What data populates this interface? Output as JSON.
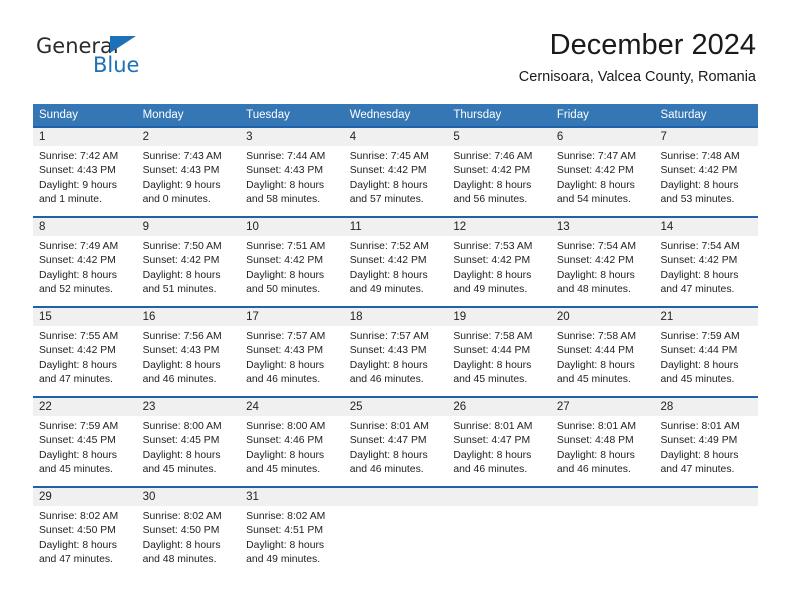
{
  "brand": {
    "name_part1": "General",
    "name_part2": "Blue",
    "accent_color": "#1d71b8",
    "triangle_icon": "triangle-icon"
  },
  "header": {
    "title": "December 2024",
    "subtitle": "Cernisoara, Valcea County, Romania"
  },
  "calendar": {
    "header_bg": "#3576b5",
    "rule_color": "#1f62ab",
    "day_band_bg": "#f0f0f0",
    "weekdays": [
      "Sunday",
      "Monday",
      "Tuesday",
      "Wednesday",
      "Thursday",
      "Friday",
      "Saturday"
    ],
    "weeks": [
      [
        {
          "day": "1",
          "sunrise": "Sunrise: 7:42 AM",
          "sunset": "Sunset: 4:43 PM",
          "daylight1": "Daylight: 9 hours",
          "daylight2": "and 1 minute."
        },
        {
          "day": "2",
          "sunrise": "Sunrise: 7:43 AM",
          "sunset": "Sunset: 4:43 PM",
          "daylight1": "Daylight: 9 hours",
          "daylight2": "and 0 minutes."
        },
        {
          "day": "3",
          "sunrise": "Sunrise: 7:44 AM",
          "sunset": "Sunset: 4:43 PM",
          "daylight1": "Daylight: 8 hours",
          "daylight2": "and 58 minutes."
        },
        {
          "day": "4",
          "sunrise": "Sunrise: 7:45 AM",
          "sunset": "Sunset: 4:42 PM",
          "daylight1": "Daylight: 8 hours",
          "daylight2": "and 57 minutes."
        },
        {
          "day": "5",
          "sunrise": "Sunrise: 7:46 AM",
          "sunset": "Sunset: 4:42 PM",
          "daylight1": "Daylight: 8 hours",
          "daylight2": "and 56 minutes."
        },
        {
          "day": "6",
          "sunrise": "Sunrise: 7:47 AM",
          "sunset": "Sunset: 4:42 PM",
          "daylight1": "Daylight: 8 hours",
          "daylight2": "and 54 minutes."
        },
        {
          "day": "7",
          "sunrise": "Sunrise: 7:48 AM",
          "sunset": "Sunset: 4:42 PM",
          "daylight1": "Daylight: 8 hours",
          "daylight2": "and 53 minutes."
        }
      ],
      [
        {
          "day": "8",
          "sunrise": "Sunrise: 7:49 AM",
          "sunset": "Sunset: 4:42 PM",
          "daylight1": "Daylight: 8 hours",
          "daylight2": "and 52 minutes."
        },
        {
          "day": "9",
          "sunrise": "Sunrise: 7:50 AM",
          "sunset": "Sunset: 4:42 PM",
          "daylight1": "Daylight: 8 hours",
          "daylight2": "and 51 minutes."
        },
        {
          "day": "10",
          "sunrise": "Sunrise: 7:51 AM",
          "sunset": "Sunset: 4:42 PM",
          "daylight1": "Daylight: 8 hours",
          "daylight2": "and 50 minutes."
        },
        {
          "day": "11",
          "sunrise": "Sunrise: 7:52 AM",
          "sunset": "Sunset: 4:42 PM",
          "daylight1": "Daylight: 8 hours",
          "daylight2": "and 49 minutes."
        },
        {
          "day": "12",
          "sunrise": "Sunrise: 7:53 AM",
          "sunset": "Sunset: 4:42 PM",
          "daylight1": "Daylight: 8 hours",
          "daylight2": "and 49 minutes."
        },
        {
          "day": "13",
          "sunrise": "Sunrise: 7:54 AM",
          "sunset": "Sunset: 4:42 PM",
          "daylight1": "Daylight: 8 hours",
          "daylight2": "and 48 minutes."
        },
        {
          "day": "14",
          "sunrise": "Sunrise: 7:54 AM",
          "sunset": "Sunset: 4:42 PM",
          "daylight1": "Daylight: 8 hours",
          "daylight2": "and 47 minutes."
        }
      ],
      [
        {
          "day": "15",
          "sunrise": "Sunrise: 7:55 AM",
          "sunset": "Sunset: 4:42 PM",
          "daylight1": "Daylight: 8 hours",
          "daylight2": "and 47 minutes."
        },
        {
          "day": "16",
          "sunrise": "Sunrise: 7:56 AM",
          "sunset": "Sunset: 4:43 PM",
          "daylight1": "Daylight: 8 hours",
          "daylight2": "and 46 minutes."
        },
        {
          "day": "17",
          "sunrise": "Sunrise: 7:57 AM",
          "sunset": "Sunset: 4:43 PM",
          "daylight1": "Daylight: 8 hours",
          "daylight2": "and 46 minutes."
        },
        {
          "day": "18",
          "sunrise": "Sunrise: 7:57 AM",
          "sunset": "Sunset: 4:43 PM",
          "daylight1": "Daylight: 8 hours",
          "daylight2": "and 46 minutes."
        },
        {
          "day": "19",
          "sunrise": "Sunrise: 7:58 AM",
          "sunset": "Sunset: 4:44 PM",
          "daylight1": "Daylight: 8 hours",
          "daylight2": "and 45 minutes."
        },
        {
          "day": "20",
          "sunrise": "Sunrise: 7:58 AM",
          "sunset": "Sunset: 4:44 PM",
          "daylight1": "Daylight: 8 hours",
          "daylight2": "and 45 minutes."
        },
        {
          "day": "21",
          "sunrise": "Sunrise: 7:59 AM",
          "sunset": "Sunset: 4:44 PM",
          "daylight1": "Daylight: 8 hours",
          "daylight2": "and 45 minutes."
        }
      ],
      [
        {
          "day": "22",
          "sunrise": "Sunrise: 7:59 AM",
          "sunset": "Sunset: 4:45 PM",
          "daylight1": "Daylight: 8 hours",
          "daylight2": "and 45 minutes."
        },
        {
          "day": "23",
          "sunrise": "Sunrise: 8:00 AM",
          "sunset": "Sunset: 4:45 PM",
          "daylight1": "Daylight: 8 hours",
          "daylight2": "and 45 minutes."
        },
        {
          "day": "24",
          "sunrise": "Sunrise: 8:00 AM",
          "sunset": "Sunset: 4:46 PM",
          "daylight1": "Daylight: 8 hours",
          "daylight2": "and 45 minutes."
        },
        {
          "day": "25",
          "sunrise": "Sunrise: 8:01 AM",
          "sunset": "Sunset: 4:47 PM",
          "daylight1": "Daylight: 8 hours",
          "daylight2": "and 46 minutes."
        },
        {
          "day": "26",
          "sunrise": "Sunrise: 8:01 AM",
          "sunset": "Sunset: 4:47 PM",
          "daylight1": "Daylight: 8 hours",
          "daylight2": "and 46 minutes."
        },
        {
          "day": "27",
          "sunrise": "Sunrise: 8:01 AM",
          "sunset": "Sunset: 4:48 PM",
          "daylight1": "Daylight: 8 hours",
          "daylight2": "and 46 minutes."
        },
        {
          "day": "28",
          "sunrise": "Sunrise: 8:01 AM",
          "sunset": "Sunset: 4:49 PM",
          "daylight1": "Daylight: 8 hours",
          "daylight2": "and 47 minutes."
        }
      ],
      [
        {
          "day": "29",
          "sunrise": "Sunrise: 8:02 AM",
          "sunset": "Sunset: 4:50 PM",
          "daylight1": "Daylight: 8 hours",
          "daylight2": "and 47 minutes."
        },
        {
          "day": "30",
          "sunrise": "Sunrise: 8:02 AM",
          "sunset": "Sunset: 4:50 PM",
          "daylight1": "Daylight: 8 hours",
          "daylight2": "and 48 minutes."
        },
        {
          "day": "31",
          "sunrise": "Sunrise: 8:02 AM",
          "sunset": "Sunset: 4:51 PM",
          "daylight1": "Daylight: 8 hours",
          "daylight2": "and 49 minutes."
        },
        {
          "day": "",
          "sunrise": "",
          "sunset": "",
          "daylight1": "",
          "daylight2": ""
        },
        {
          "day": "",
          "sunrise": "",
          "sunset": "",
          "daylight1": "",
          "daylight2": ""
        },
        {
          "day": "",
          "sunrise": "",
          "sunset": "",
          "daylight1": "",
          "daylight2": ""
        },
        {
          "day": "",
          "sunrise": "",
          "sunset": "",
          "daylight1": "",
          "daylight2": ""
        }
      ]
    ]
  }
}
